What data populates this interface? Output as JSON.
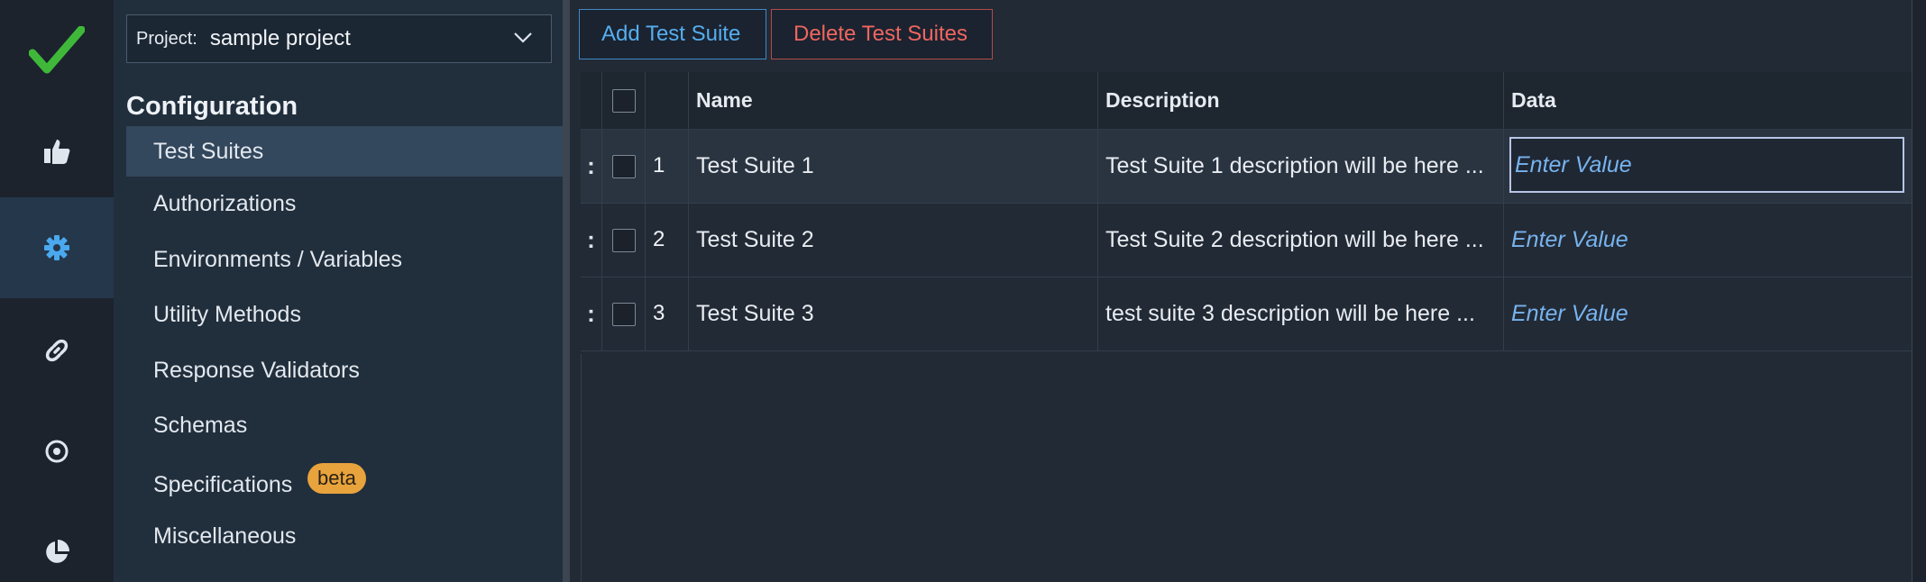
{
  "rail": {
    "items": [
      {
        "icon": "checkmark-logo-icon",
        "active": false
      },
      {
        "icon": "thumbs-up-icon",
        "active": false
      },
      {
        "icon": "gear-icon",
        "active": true
      },
      {
        "icon": "link-icon",
        "active": false
      },
      {
        "icon": "target-icon",
        "active": false
      },
      {
        "icon": "pie-chart-icon",
        "active": false
      }
    ]
  },
  "sidebar": {
    "project_label": "Project:",
    "project_value": "sample project",
    "section_title": "Configuration",
    "items": [
      {
        "label": "Test Suites"
      },
      {
        "label": "Authorizations"
      },
      {
        "label": "Environments / Variables"
      },
      {
        "label": "Utility Methods"
      },
      {
        "label": "Response Validators"
      },
      {
        "label": "Schemas"
      },
      {
        "label": "Specifications",
        "badge": "beta"
      },
      {
        "label": "Miscellaneous"
      }
    ]
  },
  "toolbar": {
    "add_label": "Add Test Suite",
    "delete_label": "Delete Test Suites"
  },
  "table": {
    "columns": [
      "Name",
      "Description",
      "Data"
    ],
    "rows": [
      {
        "num": "1",
        "name": "Test Suite 1",
        "description": "Test Suite 1 description will be here ...",
        "data_placeholder": "Enter Value"
      },
      {
        "num": "2",
        "name": "Test Suite 2",
        "description": "Test Suite 2 description will be here ...",
        "data_placeholder": "Enter Value"
      },
      {
        "num": "3",
        "name": "Test Suite 3",
        "description": "test suite 3 description will be here ...",
        "data_placeholder": "Enter Value"
      }
    ],
    "drag_glyph": ":"
  },
  "colors": {
    "accent_blue": "#55aef0",
    "danger_red": "#ef6660",
    "badge_orange": "#e8a33d",
    "logo_green": "#3fb83a"
  }
}
